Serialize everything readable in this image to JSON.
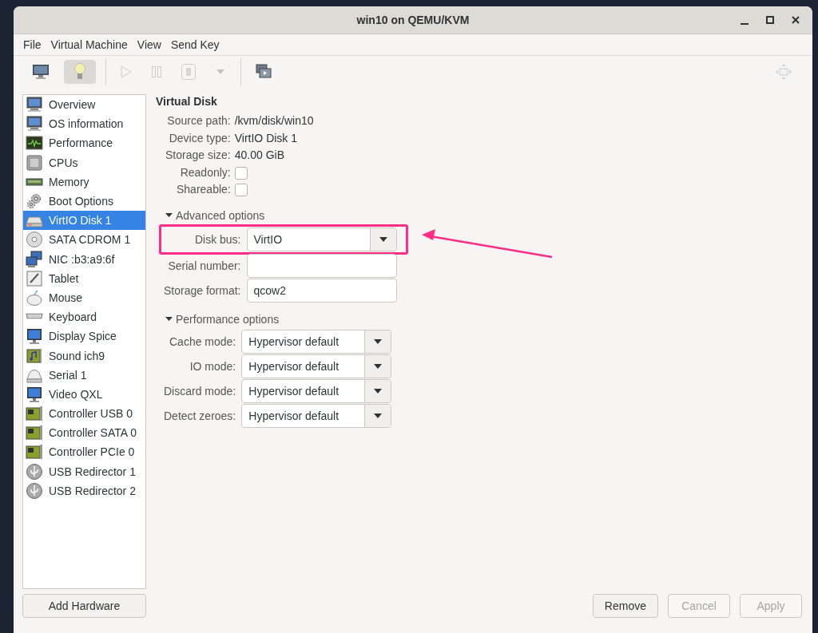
{
  "window": {
    "title": "win10 on QEMU/KVM"
  },
  "menu": [
    "File",
    "Virtual Machine",
    "View",
    "Send Key"
  ],
  "toolbar": [
    {
      "kind": "console",
      "selected": false,
      "disabled": false
    },
    {
      "kind": "details",
      "selected": true,
      "disabled": false
    },
    {
      "kind": "separator"
    },
    {
      "kind": "run",
      "selected": false,
      "disabled": true
    },
    {
      "kind": "pause",
      "selected": false,
      "disabled": true
    },
    {
      "kind": "shutdown",
      "selected": false,
      "disabled": true
    },
    {
      "kind": "dropdown",
      "selected": false,
      "disabled": true
    },
    {
      "kind": "separator"
    },
    {
      "kind": "snapshots",
      "selected": false,
      "disabled": false
    },
    {
      "kind": "spacer"
    },
    {
      "kind": "fullscreen",
      "selected": false,
      "disabled": true
    }
  ],
  "sidebar": {
    "items": [
      {
        "label": "Overview",
        "kind": "monitor",
        "selected": false
      },
      {
        "label": "OS information",
        "kind": "monitor",
        "selected": false
      },
      {
        "label": "Performance",
        "kind": "chart",
        "selected": false
      },
      {
        "label": "CPUs",
        "kind": "chip",
        "selected": false
      },
      {
        "label": "Memory",
        "kind": "memory",
        "selected": false
      },
      {
        "label": "Boot Options",
        "kind": "gears",
        "selected": false
      },
      {
        "label": "VirtIO Disk 1",
        "kind": "disk",
        "selected": true
      },
      {
        "label": "SATA CDROM 1",
        "kind": "cdrom",
        "selected": false
      },
      {
        "label": "NIC :b3:a9:6f",
        "kind": "network",
        "selected": false
      },
      {
        "label": "Tablet",
        "kind": "tablet",
        "selected": false
      },
      {
        "label": "Mouse",
        "kind": "mouse",
        "selected": false
      },
      {
        "label": "Keyboard",
        "kind": "keyboard",
        "selected": false
      },
      {
        "label": "Display Spice",
        "kind": "display",
        "selected": false
      },
      {
        "label": "Sound ich9",
        "kind": "sound",
        "selected": false
      },
      {
        "label": "Serial 1",
        "kind": "serial",
        "selected": false
      },
      {
        "label": "Video QXL",
        "kind": "display",
        "selected": false
      },
      {
        "label": "Controller USB 0",
        "kind": "card",
        "selected": false
      },
      {
        "label": "Controller SATA 0",
        "kind": "card",
        "selected": false
      },
      {
        "label": "Controller PCIe 0",
        "kind": "card",
        "selected": false
      },
      {
        "label": "USB Redirector 1",
        "kind": "usb",
        "selected": false
      },
      {
        "label": "USB Redirector 2",
        "kind": "usb",
        "selected": false
      }
    ]
  },
  "details": {
    "title": "Virtual Disk",
    "info": [
      {
        "label": "Source path:",
        "value": "/kvm/disk/win10"
      },
      {
        "label": "Device type:",
        "value": "VirtIO Disk 1"
      },
      {
        "label": "Storage size:",
        "value": "40.00 GiB"
      }
    ],
    "checks": [
      {
        "label": "Readonly:",
        "checked": false
      },
      {
        "label": "Shareable:",
        "checked": false
      }
    ],
    "sections": [
      {
        "title": "Advanced options",
        "expanded": true,
        "fields": [
          {
            "kind": "combo",
            "label": "Disk bus:",
            "value": "VirtIO",
            "highlighted": true
          },
          {
            "kind": "entry",
            "label": "Serial number:",
            "highlighted": false
          },
          {
            "kind": "entry",
            "label": "Storage format:",
            "value": "qcow2",
            "highlighted": false
          }
        ]
      },
      {
        "title": "Performance options",
        "expanded": true,
        "fields": [
          {
            "kind": "combo",
            "label": "Cache mode:",
            "value": "Hypervisor default",
            "highlighted": false
          },
          {
            "kind": "combo",
            "label": "IO mode:",
            "value": "Hypervisor default",
            "highlighted": false
          },
          {
            "kind": "combo",
            "label": "Discard mode:",
            "value": "Hypervisor default",
            "highlighted": false
          },
          {
            "kind": "combo",
            "label": "Detect zeroes:",
            "value": "Hypervisor default",
            "highlighted": false
          }
        ]
      }
    ]
  },
  "footer": {
    "add_button": "Add Hardware",
    "buttons": [
      {
        "label": "Remove",
        "disabled": false
      },
      {
        "label": "Cancel",
        "disabled": true
      },
      {
        "label": "Apply",
        "disabled": true
      }
    ]
  }
}
